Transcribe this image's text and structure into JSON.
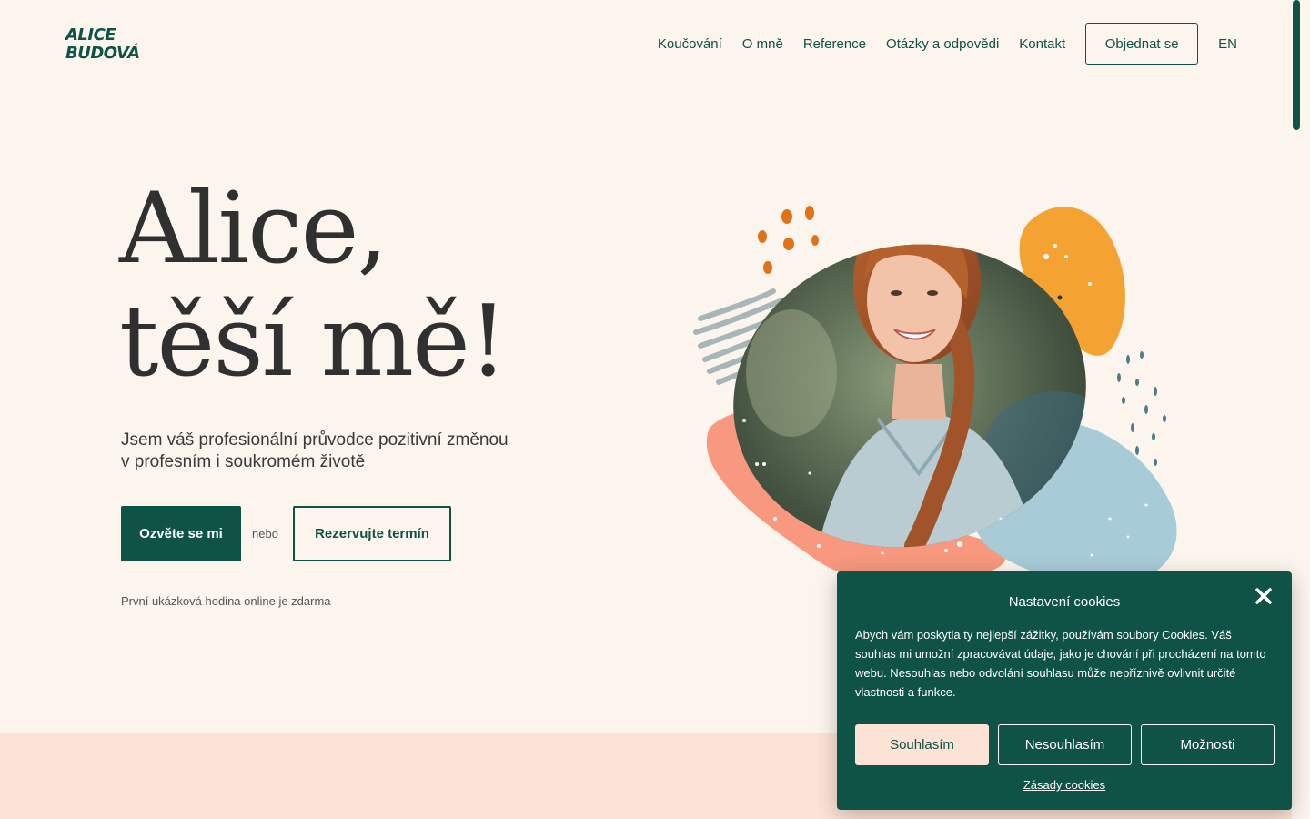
{
  "header": {
    "logo_line1": "ALICE",
    "logo_line2": "BUDOVÁ",
    "nav": [
      {
        "label": "Koučování"
      },
      {
        "label": "O mně"
      },
      {
        "label": "Reference"
      },
      {
        "label": "Otázky a odpovědi"
      },
      {
        "label": "Kontakt"
      }
    ],
    "cta_label": "Objednat se",
    "lang_label": "EN"
  },
  "hero": {
    "title_line1": "Alice,",
    "title_line2": "těší mě!",
    "subtitle_line1": "Jsem váš profesionální průvodce pozitivní změnou",
    "subtitle_line2": "v profesním i soukromém životě",
    "primary_button": "Ozvěte se mi",
    "or_text": "nebo",
    "secondary_button": "Rezervujte termín",
    "note": "První ukázková hodina online je zdarma"
  },
  "cookie": {
    "title": "Nastavení cookies",
    "text": "Abych vám poskytla ty nejlepší zážitky, používám soubory Cookies. Váš souhlas mi umožní zpracovávat údaje, jako je chování při procházení na tomto webu. Nesouhlas nebo odvolání souhlasu může nepříznivě ovlivnit určité vlastnosti a funkce.",
    "accept_label": "Souhlasím",
    "decline_label": "Nesouhlasím",
    "options_label": "Možnosti",
    "policy_link": "Zásady cookies"
  },
  "colors": {
    "brand_green": "#0f5246",
    "background": "#fcf5ee",
    "peach": "#fde3d6",
    "salmon": "#f7987f",
    "orange": "#f4a232",
    "light_blue": "#a7cbd7"
  },
  "icons": {
    "close": "close-icon"
  }
}
